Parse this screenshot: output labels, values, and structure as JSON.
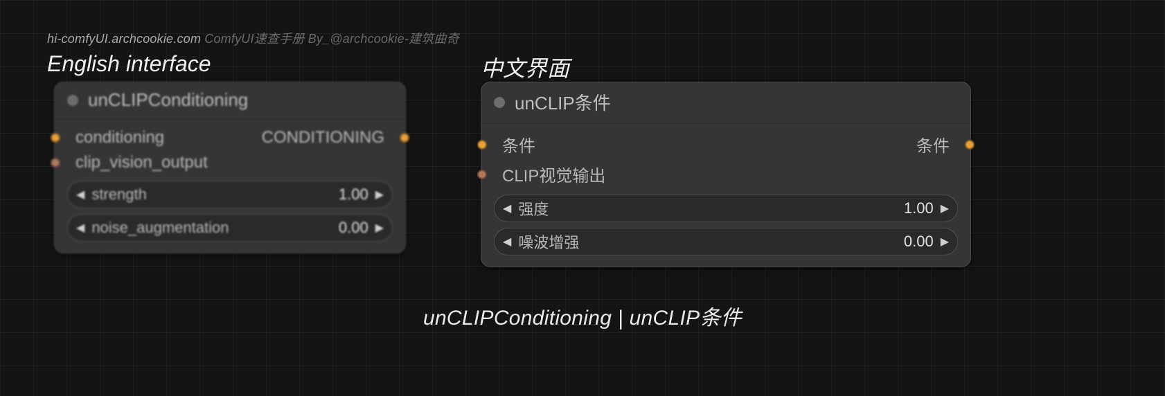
{
  "watermark": {
    "site": "hi-comfyUI.archcookie.com",
    "rest": " ComfyUI速查手册 By_@archcookie-建筑曲奇"
  },
  "labels": {
    "english": "English interface",
    "chinese": "中文界面"
  },
  "node_en": {
    "title": "unCLIPConditioning",
    "inputs": {
      "conditioning": "conditioning",
      "clip_vision_output": "clip_vision_output"
    },
    "outputs": {
      "conditioning": "CONDITIONING"
    },
    "widgets": {
      "strength": {
        "name": "strength",
        "value": "1.00"
      },
      "noise_augmentation": {
        "name": "noise_augmentation",
        "value": "0.00"
      }
    }
  },
  "node_zh": {
    "title": "unCLIP条件",
    "inputs": {
      "conditioning": "条件",
      "clip_vision_output": "CLIP视觉输出"
    },
    "outputs": {
      "conditioning": "条件"
    },
    "widgets": {
      "strength": {
        "name": "强度",
        "value": "1.00"
      },
      "noise_augmentation": {
        "name": "噪波增强",
        "value": "0.00"
      }
    }
  },
  "footer": "unCLIPConditioning | unCLIP条件",
  "colors": {
    "conditioning_port": "#e6a13c",
    "clip_vision_port": "#b07a5a"
  }
}
